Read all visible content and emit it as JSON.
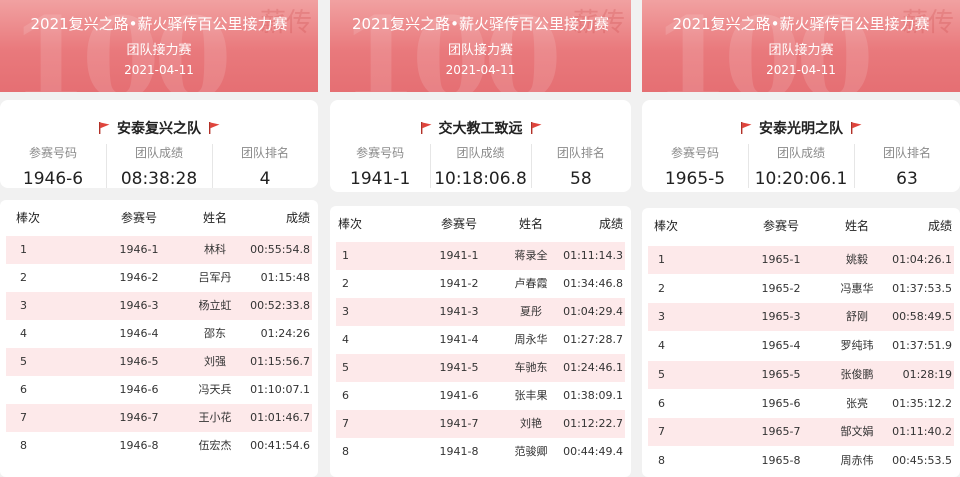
{
  "panels": [
    {
      "banner": {
        "title": "2021复兴之路•薪火驿传百公里接力赛",
        "subtitle": "团队接力赛",
        "date": "2021-04-11"
      },
      "team": {
        "name": "安泰复兴之队",
        "bib_label": "参赛号码",
        "bib": "1946-6",
        "time_label": "团队成绩",
        "time": "08:38:28",
        "rank_label": "团队排名",
        "rank": "4"
      },
      "table": {
        "headers": [
          "棒次",
          "参赛号",
          "姓名",
          "成绩"
        ],
        "rows": [
          [
            "1",
            "1946-1",
            "林科",
            "00:55:54.8"
          ],
          [
            "2",
            "1946-2",
            "吕军丹",
            "01:15:48"
          ],
          [
            "3",
            "1946-3",
            "杨立虹",
            "00:52:33.8"
          ],
          [
            "4",
            "1946-4",
            "邵东",
            "01:24:26"
          ],
          [
            "5",
            "1946-5",
            "刘强",
            "01:15:56.7"
          ],
          [
            "6",
            "1946-6",
            "冯天兵",
            "01:10:07.1"
          ],
          [
            "7",
            "1946-7",
            "王小花",
            "01:01:46.7"
          ],
          [
            "8",
            "1946-8",
            "伍宏杰",
            "00:41:54.6"
          ]
        ]
      }
    },
    {
      "banner": {
        "title": "2021复兴之路•薪火驿传百公里接力赛",
        "subtitle": "团队接力赛",
        "date": "2021-04-11"
      },
      "team": {
        "name": "交大教工致远",
        "bib_label": "参赛号码",
        "bib": "1941-1",
        "time_label": "团队成绩",
        "time": "10:18:06.8",
        "rank_label": "团队排名",
        "rank": "58"
      },
      "table": {
        "headers": [
          "棒次",
          "参赛号",
          "姓名",
          "成绩"
        ],
        "rows": [
          [
            "1",
            "1941-1",
            "蒋录全",
            "01:11:14.3"
          ],
          [
            "2",
            "1941-2",
            "卢春霞",
            "01:34:46.8"
          ],
          [
            "3",
            "1941-3",
            "夏彤",
            "01:04:29.4"
          ],
          [
            "4",
            "1941-4",
            "周永华",
            "01:27:28.7"
          ],
          [
            "5",
            "1941-5",
            "车驰东",
            "01:24:46.1"
          ],
          [
            "6",
            "1941-6",
            "张丰果",
            "01:38:09.1"
          ],
          [
            "7",
            "1941-7",
            "刘艳",
            "01:12:22.7"
          ],
          [
            "8",
            "1941-8",
            "范骏卿",
            "00:44:49.4"
          ]
        ]
      }
    },
    {
      "banner": {
        "title": "2021复兴之路•薪火驿传百公里接力赛",
        "subtitle": "团队接力赛",
        "date": "2021-04-11"
      },
      "team": {
        "name": "安泰光明之队",
        "bib_label": "参赛号码",
        "bib": "1965-5",
        "time_label": "团队成绩",
        "time": "10:20:06.1",
        "rank_label": "团队排名",
        "rank": "63"
      },
      "table": {
        "headers": [
          "棒次",
          "参赛号",
          "姓名",
          "成绩"
        ],
        "rows": [
          [
            "1",
            "1965-1",
            "姚毅",
            "01:04:26.1"
          ],
          [
            "2",
            "1965-2",
            "冯惠华",
            "01:37:53.5"
          ],
          [
            "3",
            "1965-3",
            "舒刚",
            "00:58:49.5"
          ],
          [
            "4",
            "1965-4",
            "罗纯玮",
            "01:37:51.9"
          ],
          [
            "5",
            "1965-5",
            "张俊鹏",
            "01:28:19"
          ],
          [
            "6",
            "1965-6",
            "张亮",
            "01:35:12.2"
          ],
          [
            "7",
            "1965-7",
            "郜文娟",
            "01:11:40.2"
          ],
          [
            "8",
            "1965-8",
            "周赤伟",
            "00:45:53.5"
          ]
        ]
      }
    }
  ],
  "colors": {
    "banner": "#e9797c",
    "row_highlight": "#fde9ea",
    "flag": "#e0443c"
  },
  "icons": [
    "flag-icon"
  ]
}
